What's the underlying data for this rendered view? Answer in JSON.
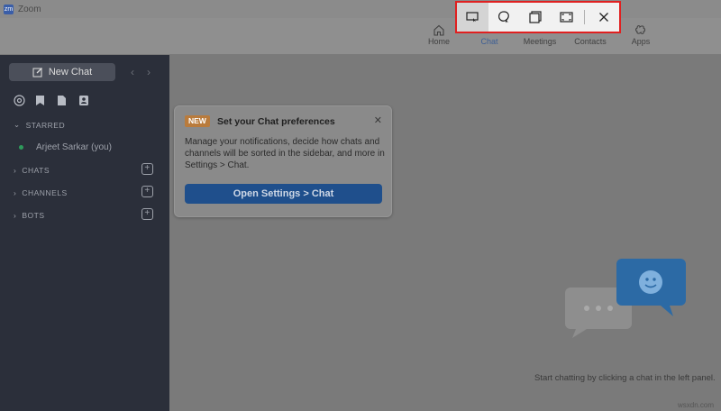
{
  "window": {
    "app_title": "Zoom",
    "logo_text": "zm"
  },
  "nav": {
    "items": [
      {
        "label": "Home",
        "icon": "home-icon"
      },
      {
        "label": "Chat",
        "icon": "chat-icon"
      },
      {
        "label": "Meetings",
        "icon": "meetings-icon"
      },
      {
        "label": "Contacts",
        "icon": "contacts-icon"
      },
      {
        "label": "Apps",
        "icon": "apps-icon"
      }
    ],
    "active": "Chat"
  },
  "snip_toolbar": {
    "modes": [
      "rectangular-snip",
      "freeform-snip",
      "window-snip",
      "fullscreen-snip"
    ],
    "active_mode": "rectangular-snip",
    "close_icon": "close-icon"
  },
  "sidebar": {
    "new_chat_label": "New Chat",
    "nav_prev": "‹",
    "nav_next": "›",
    "sections": [
      {
        "label": "STARRED",
        "expanded": true
      },
      {
        "label": "CHATS",
        "expanded": false
      },
      {
        "label": "CHANNELS",
        "expanded": false
      },
      {
        "label": "BOTS",
        "expanded": false
      }
    ],
    "starred_contact": "Arjeet Sarkar (you)"
  },
  "pref_card": {
    "badge": "NEW",
    "title": "Set your Chat preferences",
    "body": "Manage your notifications, decide how chats and channels will be sorted in the sidebar, and more in Settings > Chat.",
    "button_label": "Open Settings > Chat",
    "close": "✕"
  },
  "empty_state": {
    "hint": "Start chatting by clicking a chat in the left panel."
  },
  "watermark": "wsxdn.com",
  "colors": {
    "accent": "#1f4f8c",
    "sidebar": "#2b2f3a",
    "badge": "#b97b3c",
    "highlight": "#e02020"
  }
}
